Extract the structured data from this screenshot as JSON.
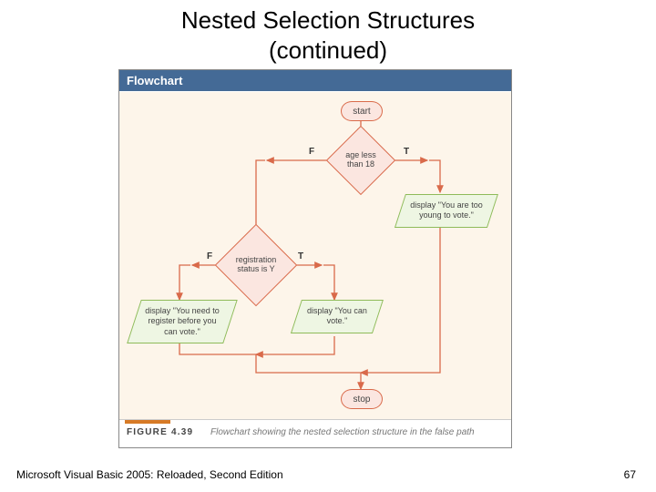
{
  "slide": {
    "title_line1": "Nested Selection Structures",
    "title_line2": "(continued)"
  },
  "flowchart": {
    "header": "Flowchart",
    "start": "start",
    "stop": "stop",
    "d1": {
      "text": "age less than 18",
      "t": "T",
      "f": "F"
    },
    "d2": {
      "text": "registration status is Y",
      "t": "T",
      "f": "F"
    },
    "p_young": "display \"You are too young to vote.\"",
    "p_register": "display \"You need to register before you can vote.\"",
    "p_canvote": "display \"You can vote.\""
  },
  "caption": {
    "label": "FIGURE 4.39",
    "text": "Flowchart showing the nested selection structure in the false path"
  },
  "footer": {
    "left": "Microsoft Visual Basic 2005: Reloaded, Second Edition",
    "page": "67"
  }
}
